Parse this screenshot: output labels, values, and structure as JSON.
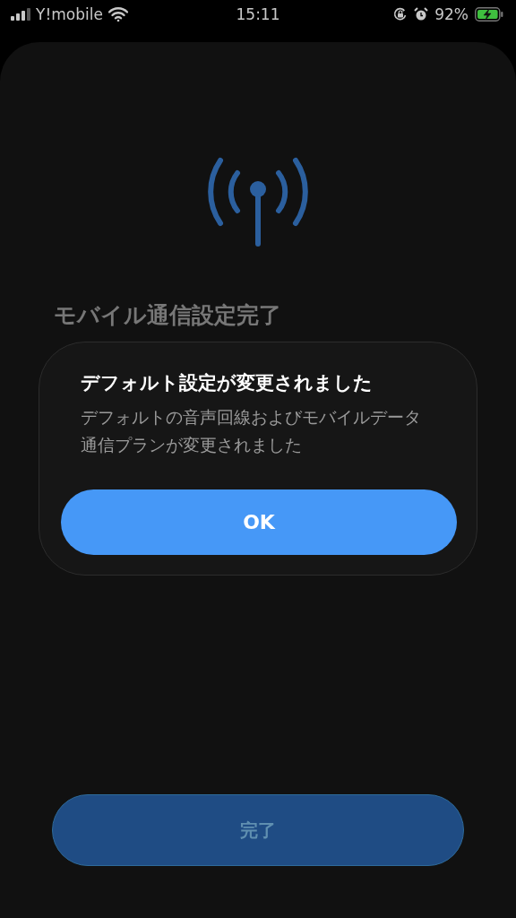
{
  "status_bar": {
    "carrier": "Y!mobile",
    "time": "15:11",
    "battery": "92%"
  },
  "screen": {
    "title": "モバイル通信設定完了",
    "done_button": "完了"
  },
  "dialog": {
    "title": "デフォルト設定が変更されました",
    "message": "デフォルトの音声回線およびモバイルデータ通信プランが変更されました",
    "ok_button": "OK"
  }
}
